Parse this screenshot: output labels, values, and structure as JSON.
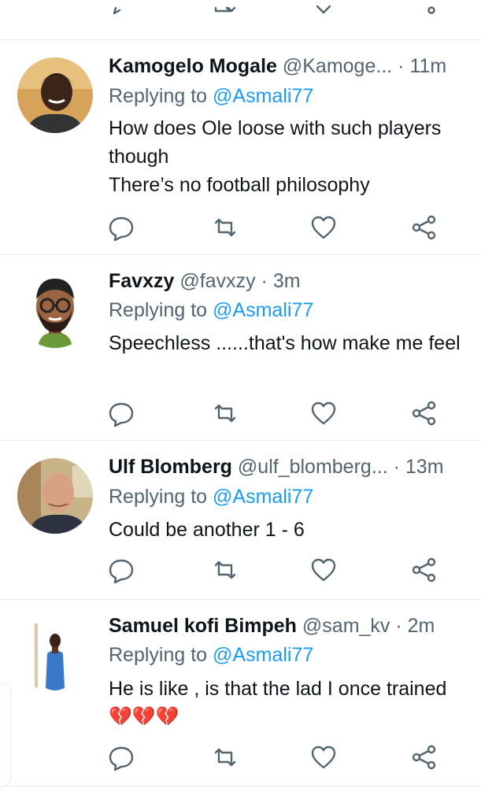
{
  "colors": {
    "name": "#0f1419",
    "secondary": "#536471",
    "link": "#1d9bf0",
    "divider": "#e6ecf0"
  },
  "tweets": [
    {
      "name": "Kamogelo Mogale",
      "handle": "@Kamoge...",
      "dot": "·",
      "time": "11m",
      "replying_label": "Replying to",
      "replying_to": "@Asmali77",
      "text": "How does Ole loose with such players though\nThere’s no football philosophy",
      "avatar": "profile-photo-young-man"
    },
    {
      "name": "Favxzy",
      "handle": "@favxzy",
      "dot": "·",
      "time": "3m",
      "replying_label": "Replying to",
      "replying_to": "@Asmali77",
      "text": "Speechless ......that's how make me feel",
      "avatar": "memoji-bearded-man-glasses"
    },
    {
      "name": "Ulf Blomberg",
      "handle": "@ulf_blomberg...",
      "dot": "·",
      "time": "13m",
      "replying_label": "Replying to",
      "replying_to": "@Asmali77",
      "text": "Could be another  1 - 6",
      "avatar": "profile-photo-bald-man"
    },
    {
      "name": "Samuel kofi Bimpeh",
      "handle": "@sam_kv",
      "dot": "·",
      "time": "2m",
      "replying_label": "Replying to",
      "replying_to": "@Asmali77",
      "text": "He is like , is that the lad I once trained",
      "emoji": "💔💔💔",
      "avatar": "profile-photo-woman-blue-dress"
    }
  ],
  "action_icons": [
    "reply-icon",
    "retweet-icon",
    "like-icon",
    "share-icon"
  ]
}
